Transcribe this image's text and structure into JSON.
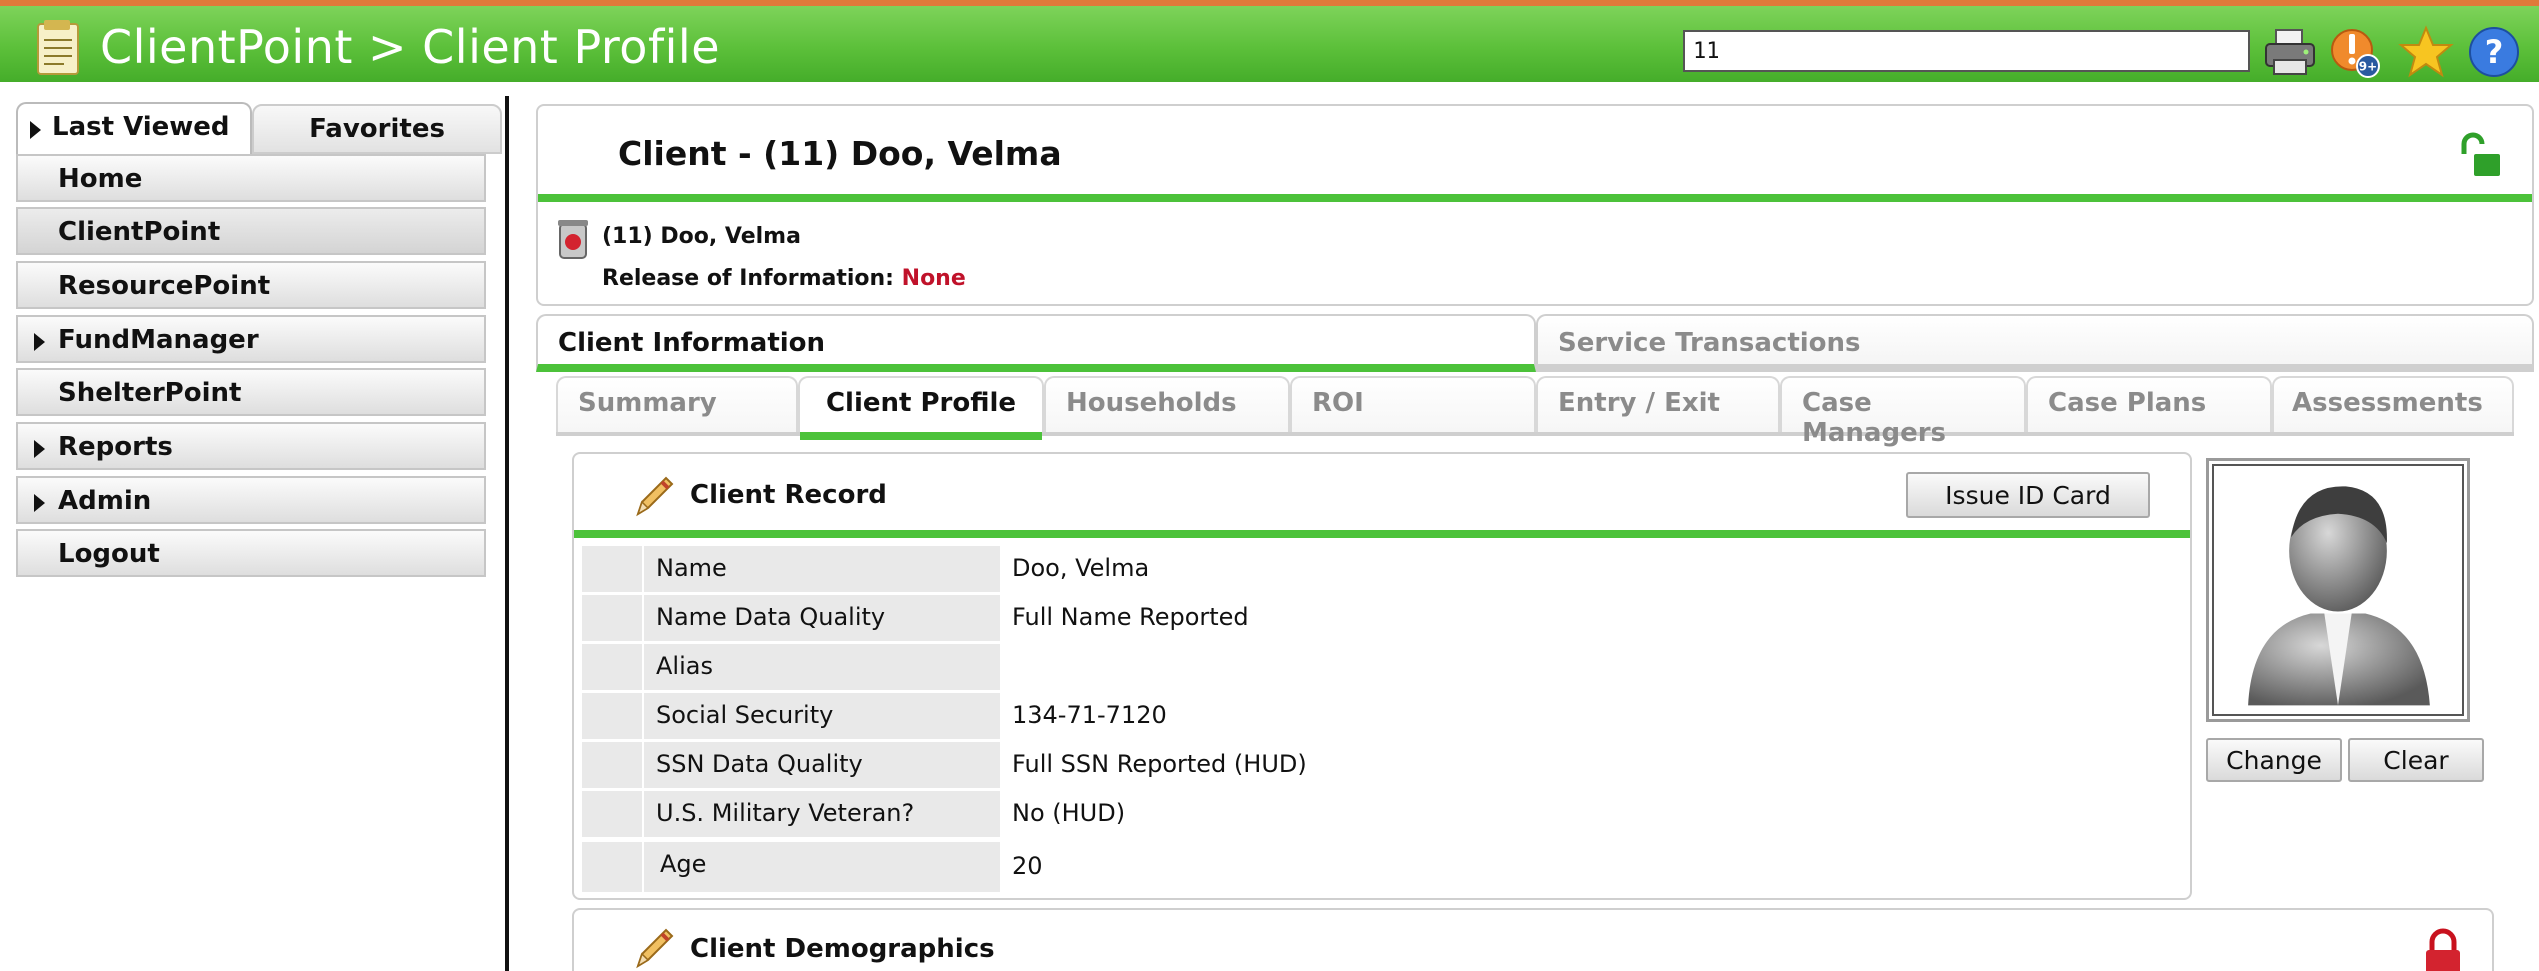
{
  "header": {
    "title": "ClientPoint > Client Profile",
    "search_value": "11",
    "notification_badge": "9+",
    "icons": [
      "printer-icon",
      "alert-icon",
      "favorite-star-icon",
      "help-icon"
    ]
  },
  "sidebar": {
    "tabs": {
      "last_viewed": "Last Viewed",
      "favorites": "Favorites"
    },
    "items": [
      {
        "label": "Home",
        "expandable": false
      },
      {
        "label": "ClientPoint",
        "expandable": false,
        "active": true
      },
      {
        "label": "ResourcePoint",
        "expandable": false
      },
      {
        "label": "FundManager",
        "expandable": true
      },
      {
        "label": "ShelterPoint",
        "expandable": false
      },
      {
        "label": "Reports",
        "expandable": true
      },
      {
        "label": "Admin",
        "expandable": true
      },
      {
        "label": "Logout",
        "expandable": false
      }
    ]
  },
  "client": {
    "title": "Client - (11) Doo, Velma",
    "name_line": "(11) Doo, Velma",
    "roi_label": "Release of Information:",
    "roi_value": "None"
  },
  "main_tabs": {
    "active": "Client Information",
    "inactive": "Service Transactions"
  },
  "sub_tabs": [
    "Summary",
    "Client Profile",
    "Households",
    "ROI",
    "Entry / Exit",
    "Case Managers",
    "Case Plans",
    "Assessments"
  ],
  "client_record": {
    "title": "Client Record",
    "issue_button": "Issue ID Card",
    "rows": [
      {
        "label": "Name",
        "value": "Doo, Velma"
      },
      {
        "label": "Name Data Quality",
        "value": "Full Name Reported"
      },
      {
        "label": "Alias",
        "value": ""
      },
      {
        "label": "Social Security",
        "value": "134-71-7120"
      },
      {
        "label": "SSN Data Quality",
        "value": "Full SSN Reported (HUD)"
      },
      {
        "label": "U.S. Military Veteran?",
        "value": "No (HUD)"
      },
      {
        "label": "Age",
        "value": "20"
      }
    ]
  },
  "photo": {
    "change_button": "Change",
    "clear_button": "Clear"
  },
  "demographics": {
    "title": "Client Demographics"
  },
  "colors": {
    "brand_green": "#4cc23a",
    "accent_orange": "#e07a3a",
    "roi_red": "#c0122a"
  }
}
